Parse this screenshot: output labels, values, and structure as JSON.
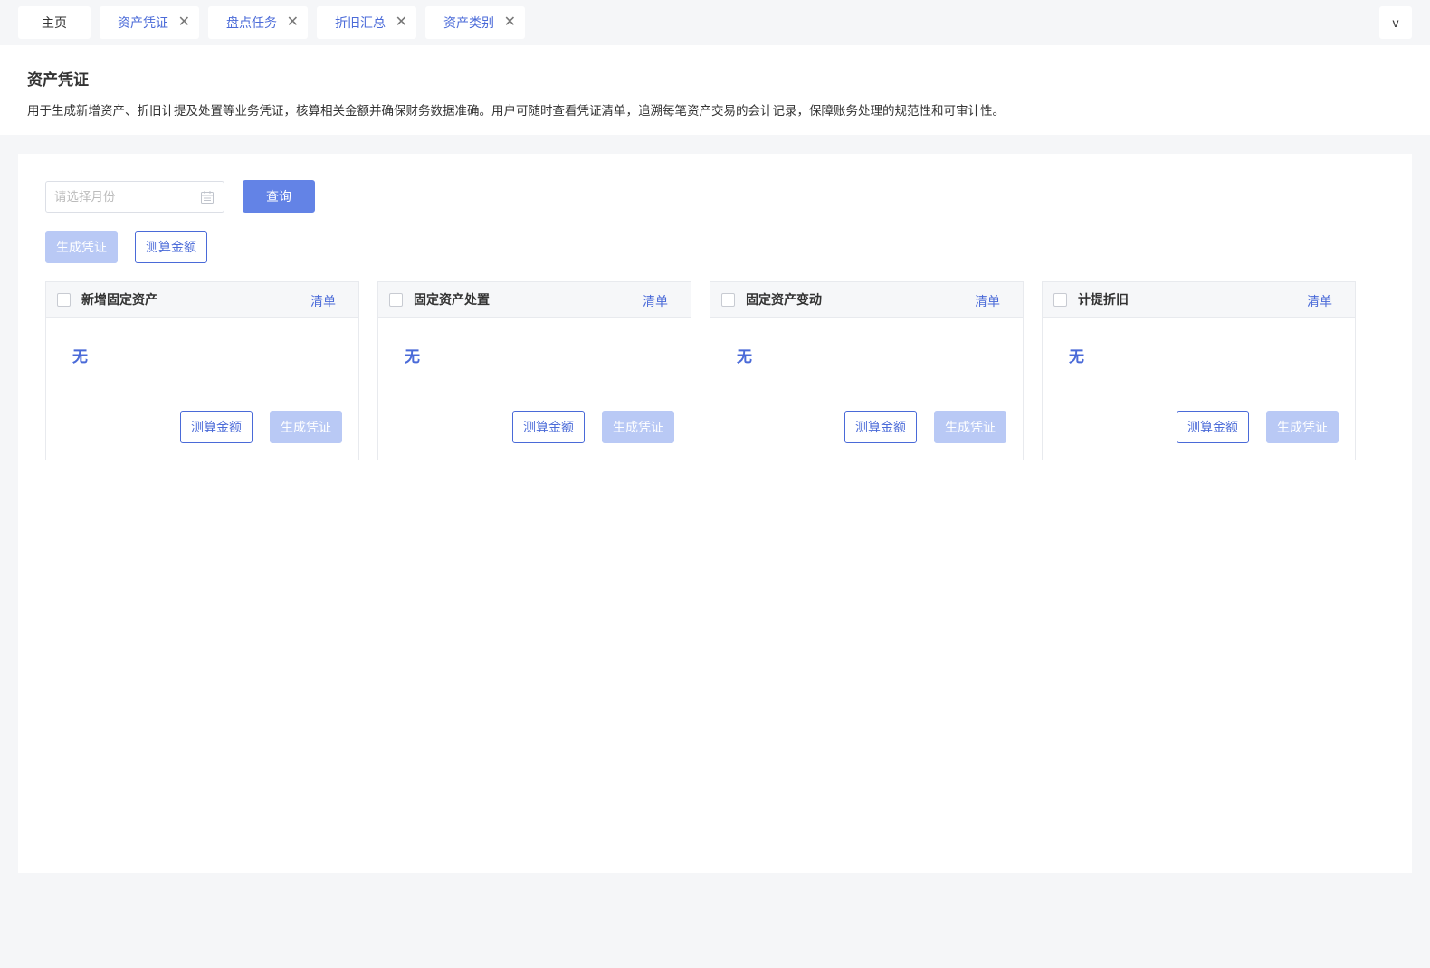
{
  "tabs": {
    "home": "主页",
    "items": [
      {
        "label": "资产凭证"
      },
      {
        "label": "盘点任务"
      },
      {
        "label": "折旧汇总"
      },
      {
        "label": "资产类别"
      }
    ],
    "more": "v",
    "close_glyph": "✕"
  },
  "header": {
    "title": "资产凭证",
    "description": "用于生成新增资产、折旧计提及处置等业务凭证，核算相关金额并确保财务数据准确。用户可随时查看凭证清单，追溯每笔资产交易的会计记录，保障账务处理的规范性和可审计性。"
  },
  "filter": {
    "month_placeholder": "请选择月份",
    "query_label": "查询"
  },
  "actions": {
    "generate_label": "生成凭证",
    "calculate_label": "测算金额"
  },
  "panels": [
    {
      "title": "新增固定资产",
      "link": "清单",
      "empty": "无",
      "calc": "测算金额",
      "gen": "生成凭证"
    },
    {
      "title": "固定资产处置",
      "link": "清单",
      "empty": "无",
      "calc": "测算金额",
      "gen": "生成凭证"
    },
    {
      "title": "固定资产变动",
      "link": "清单",
      "empty": "无",
      "calc": "测算金额",
      "gen": "生成凭证"
    },
    {
      "title": "计提折旧",
      "link": "清单",
      "empty": "无",
      "calc": "测算金额",
      "gen": "生成凭证"
    }
  ],
  "colors": {
    "accent": "#4a6ad8",
    "primary": "#6383e6",
    "primary_disabled": "#b9c9f5"
  }
}
